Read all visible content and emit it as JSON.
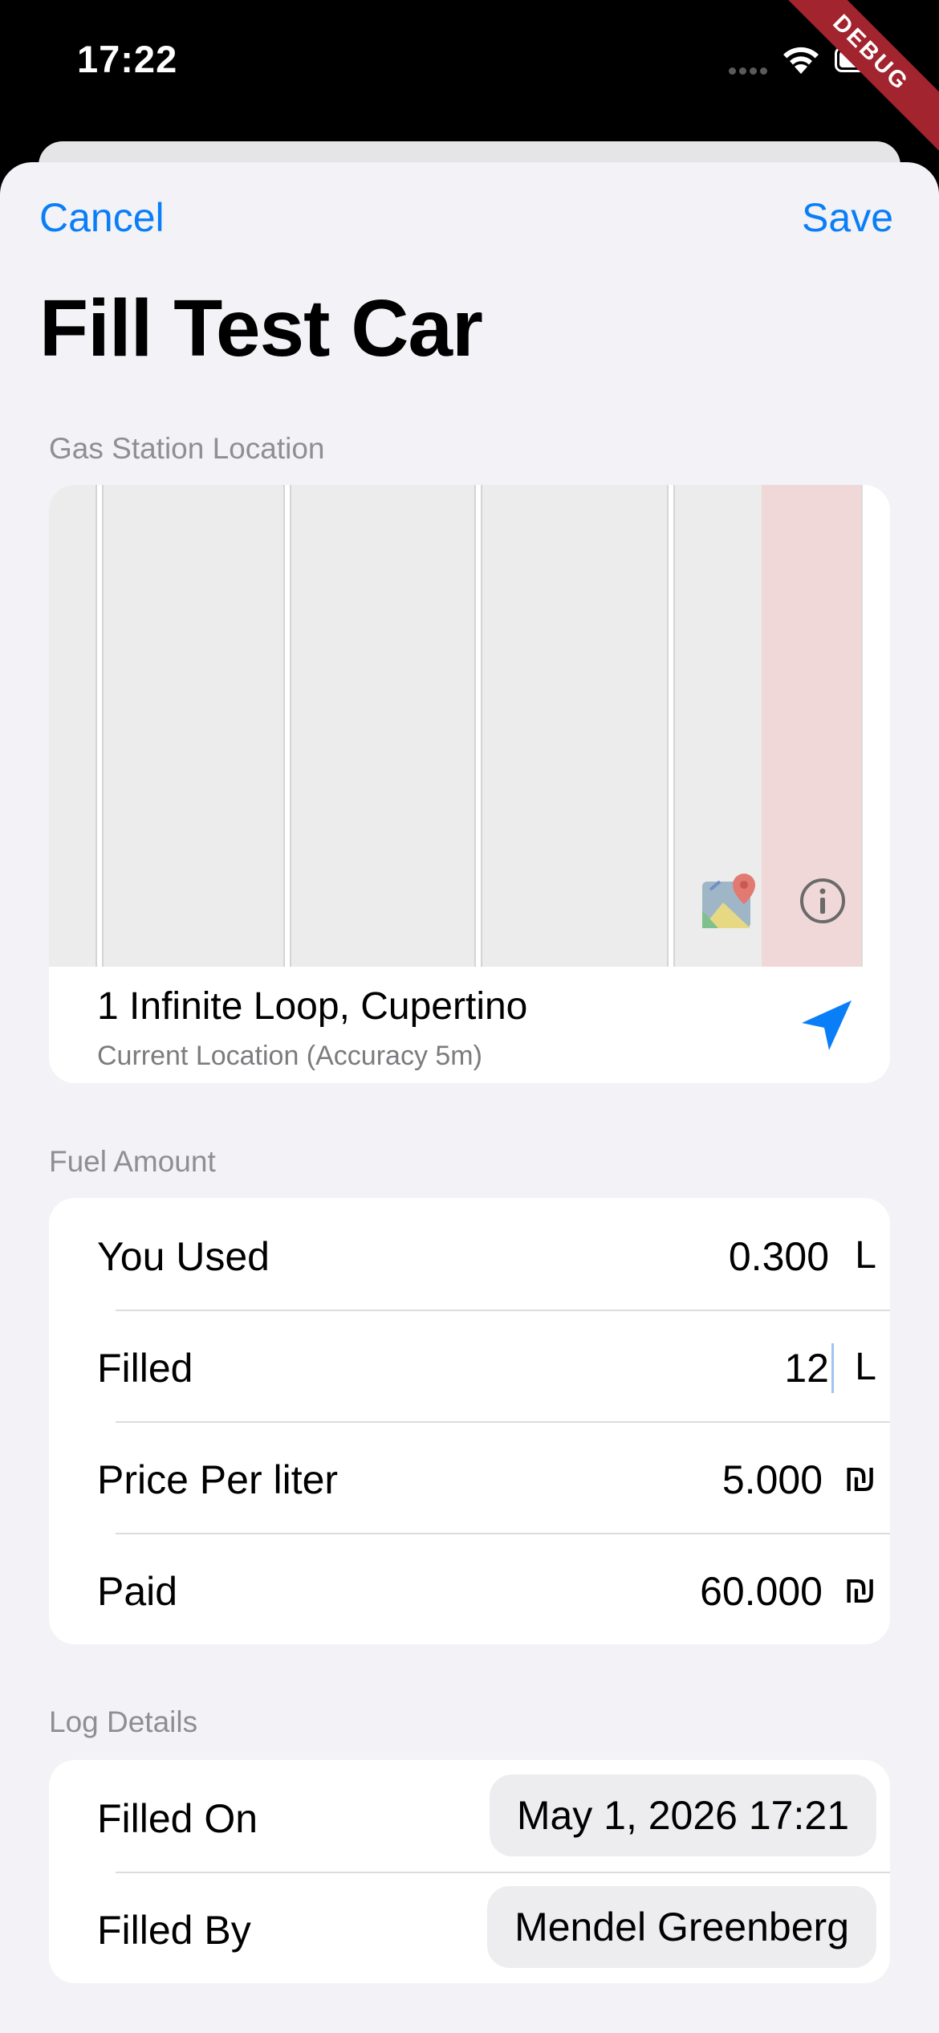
{
  "status_bar": {
    "time": "17:22",
    "debug_label": "DEBUG"
  },
  "nav": {
    "cancel_label": "Cancel",
    "save_label": "Save"
  },
  "title": "Fill Test Car",
  "location": {
    "section_title": "Gas Station Location",
    "address": "1 Infinite Loop, Cupertino",
    "subtitle": "Current Location (Accuracy 5m)"
  },
  "fuel": {
    "section_title": "Fuel Amount",
    "rows": [
      {
        "label": "You Used",
        "value": "0.300",
        "unit": "L"
      },
      {
        "label": "Filled",
        "value": "12",
        "unit": "L"
      },
      {
        "label": "Price Per liter",
        "value": "5.000",
        "unit": "₪"
      },
      {
        "label": "Paid",
        "value": "60.000",
        "unit": "₪"
      }
    ]
  },
  "log": {
    "section_title": "Log Details",
    "filled_on_label": "Filled On",
    "filled_on_value": "May 1, 2026 17:21",
    "filled_by_label": "Filled By",
    "filled_by_value": "Mendel Greenberg"
  },
  "colors": {
    "accent": "#0a7ef7",
    "background": "#f2f2f7",
    "secondary_text": "#8e8e93"
  }
}
